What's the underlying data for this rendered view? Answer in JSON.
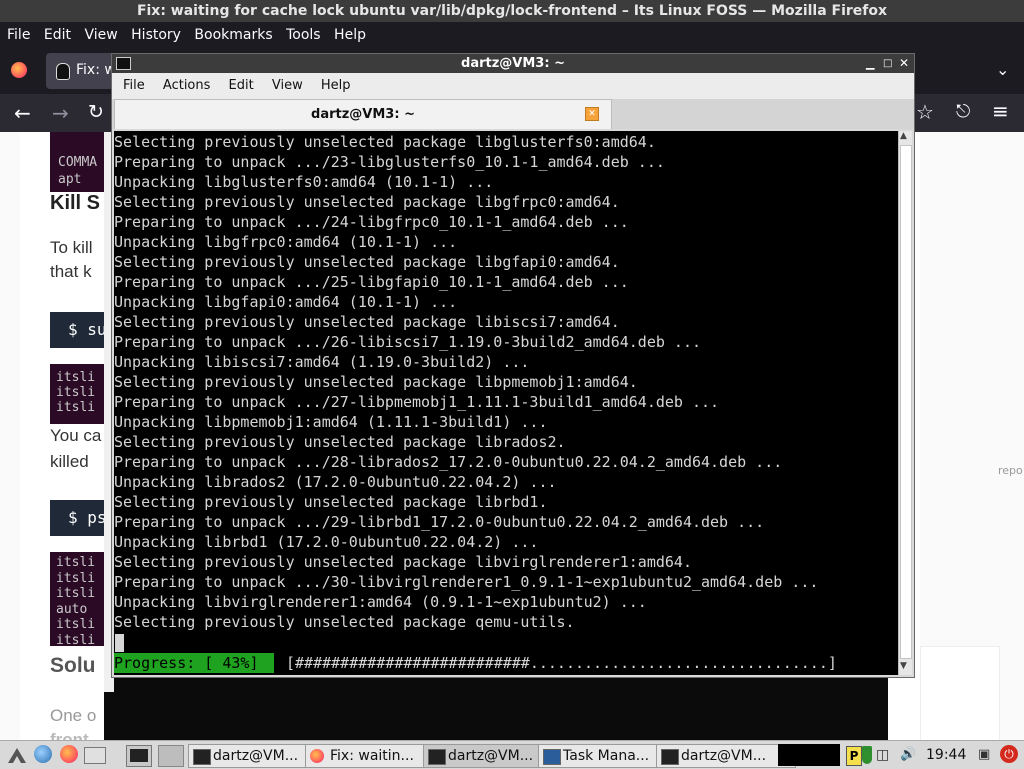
{
  "firefox": {
    "title": "Fix: waiting for cache lock ubuntu var/lib/dpkg/lock-frontend – Its Linux FOSS — Mozilla Firefox",
    "menu": [
      "File",
      "Edit",
      "View",
      "History",
      "Bookmarks",
      "Tools",
      "Help"
    ],
    "tab_partial": "Fix: w",
    "page": {
      "cmd_block1": [
        "COMMA",
        "apt"
      ],
      "heading_kill": "Kill S",
      "para1_line1": "To kill",
      "para1_line2": "that k",
      "shell1": "$ su",
      "block2": [
        "itsli",
        "itsli",
        "itsli"
      ],
      "para2_line1": "You ca",
      "para2_line2": "killed",
      "shell2": "$ ps",
      "block3": [
        "itsli",
        "itsli",
        "itsli",
        "auto",
        "itsli",
        "itsli"
      ],
      "heading_solution": "Solu",
      "para3_line1": "One o",
      "para3_line2": "front",
      "side_text": "repo"
    }
  },
  "terminal": {
    "title": "dartz@VM3: ~",
    "menu": [
      "File",
      "Actions",
      "Edit",
      "View",
      "Help"
    ],
    "tab_label": "dartz@VM3: ~",
    "lines": [
      "Selecting previously unselected package libglusterfs0:amd64.",
      "Preparing to unpack .../23-libglusterfs0_10.1-1_amd64.deb ...",
      "Unpacking libglusterfs0:amd64 (10.1-1) ...",
      "Selecting previously unselected package libgfrpc0:amd64.",
      "Preparing to unpack .../24-libgfrpc0_10.1-1_amd64.deb ...",
      "Unpacking libgfrpc0:amd64 (10.1-1) ...",
      "Selecting previously unselected package libgfapi0:amd64.",
      "Preparing to unpack .../25-libgfapi0_10.1-1_amd64.deb ...",
      "Unpacking libgfapi0:amd64 (10.1-1) ...",
      "Selecting previously unselected package libiscsi7:amd64.",
      "Preparing to unpack .../26-libiscsi7_1.19.0-3build2_amd64.deb ...",
      "Unpacking libiscsi7:amd64 (1.19.0-3build2) ...",
      "Selecting previously unselected package libpmemobj1:amd64.",
      "Preparing to unpack .../27-libpmemobj1_1.11.1-3build1_amd64.deb ...",
      "Unpacking libpmemobj1:amd64 (1.11.1-3build1) ...",
      "Selecting previously unselected package librados2.",
      "Preparing to unpack .../28-librados2_17.2.0-0ubuntu0.22.04.2_amd64.deb ...",
      "Unpacking librados2 (17.2.0-0ubuntu0.22.04.2) ...",
      "Selecting previously unselected package librbd1.",
      "Preparing to unpack .../29-librbd1_17.2.0-0ubuntu0.22.04.2_amd64.deb ...",
      "Unpacking librbd1 (17.2.0-0ubuntu0.22.04.2) ...",
      "Selecting previously unselected package libvirglrenderer1:amd64.",
      "Preparing to unpack .../30-libvirglrenderer1_0.9.1-1~exp1ubuntu2_amd64.deb ...",
      "Unpacking libvirglrenderer1:amd64 (0.9.1-1~exp1ubuntu2) ...",
      "Selecting previously unselected package qemu-utils."
    ],
    "progress_label": "Progress: [ 43%]",
    "progress_bar": "[##########################.................................]",
    "progress_percent": 43
  },
  "taskbar": {
    "tasks": [
      "dartz@VM...",
      "Fix: waitin...",
      "dartz@VM...",
      "Task Mana...",
      "dartz@VM..."
    ],
    "clock": "19:44"
  },
  "colors": {
    "progress_green": "#1fa21f",
    "terminal_bg": "#000000",
    "terminal_fg": "#d6d6d6"
  }
}
